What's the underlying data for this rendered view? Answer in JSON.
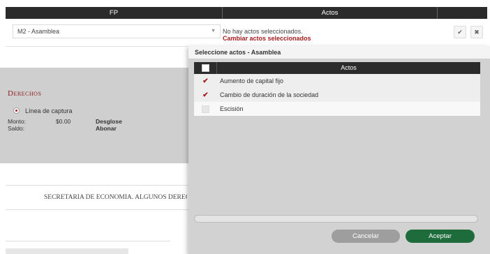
{
  "header": {
    "fp": "FP",
    "actos": "Actos"
  },
  "form": {
    "fp_select_value": "M2 - Asamblea",
    "actos_status": "No hay actos seleccionados.",
    "actos_change_link": "Cambiar actos seleccionados",
    "confirm_icon": "check-icon",
    "cancel_icon": "close-icon"
  },
  "derechos": {
    "title": "Derechos",
    "radio_label": "Línea de captura",
    "monto_label": "Monto:",
    "monto_value": "$0.00",
    "saldo_label": "Saldo:",
    "desglose_link": "Desglose",
    "abonar_link": "Abonar"
  },
  "notice": "SECRETARÍA DE ECONOMÍA. ALGUNOS DERECHOS RESERVADOS",
  "modal": {
    "title": "Seleccione actos - Asamblea",
    "column_header": "Actos",
    "rows": [
      {
        "label": "Aumento de capital fijo",
        "checked": "✔"
      },
      {
        "label": "Cambio de duración de la sociedad",
        "checked": "✔"
      },
      {
        "label": "Escisión",
        "checked": ""
      }
    ],
    "cancel_label": "Cancelar",
    "accept_label": "Aceptar"
  },
  "colors": {
    "accent_red": "#a31d1d",
    "accept_green": "#1e6b3c",
    "header_dark": "#2b2b2b"
  }
}
